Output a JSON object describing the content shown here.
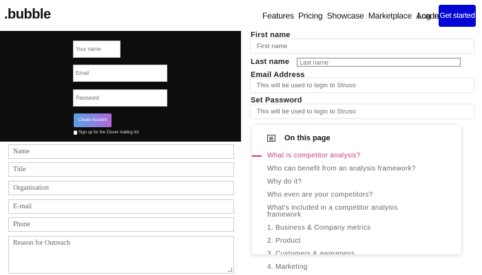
{
  "nav": {
    "logo": ".bubble",
    "links": [
      "Features",
      "Pricing",
      "Showcase",
      "Marketplace",
      "Academy"
    ],
    "login": "Log in",
    "get_started": "Get started"
  },
  "signup_dark": {
    "your_name_placeholder": "Your name",
    "email_placeholder": "Email",
    "password_placeholder": "Password",
    "create_account": "Create Account",
    "mailing_list": "Sign up for the Clover mailing list"
  },
  "contact_form": {
    "name": "Name",
    "title": "Title",
    "organization": "Organization",
    "email": "E-mail",
    "phone": "Phone",
    "reason": "Reason for Outreach"
  },
  "register_form": {
    "first_name_label": "First name",
    "first_name_placeholder": "First name",
    "last_name_label": "Last name",
    "last_name_placeholder": "Last name",
    "email_label": "Email Address",
    "email_placeholder": "This will be used to login to Struso",
    "password_label": "Set Password",
    "password_placeholder": "This will be used to login to Struso"
  },
  "toc": {
    "heading": "On this page",
    "items": [
      "What is competitor analysis?",
      "Who can benefit from an analysis framework?",
      "Why do it?",
      "Who even are your competitors?",
      "What's included in a competitor analysis",
      "framework",
      "1. Business & Company metrics",
      "2. Product",
      "3. Customers & awareness"
    ],
    "overflow_item": "4. Marketing",
    "active_color": "#c23f7e"
  },
  "colors": {
    "brand_blue": "#0205d3",
    "dark_panel": "#0d0d0d"
  }
}
